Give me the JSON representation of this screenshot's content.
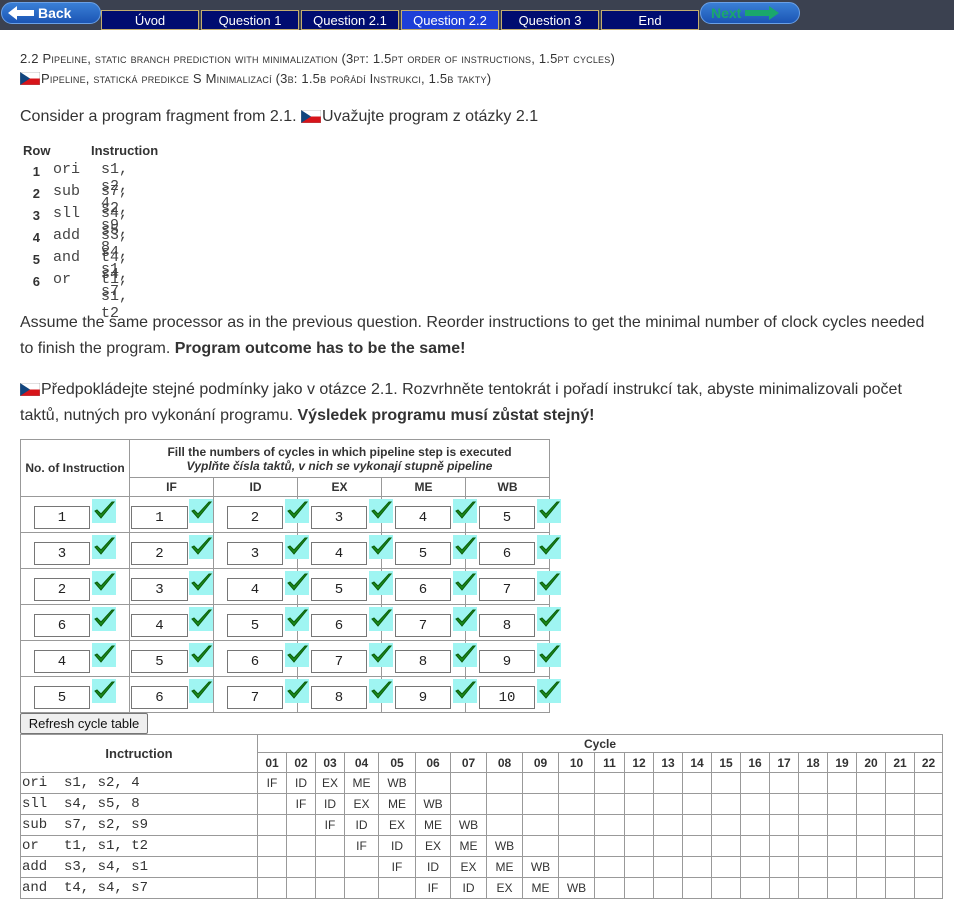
{
  "nav": {
    "back_label": "Back",
    "next_label": "Next",
    "tabs": [
      "Úvod",
      "Question 1",
      "Question 2.1",
      "Question 2.2",
      "Question 3",
      "End"
    ],
    "active_tab": "Question 2.2"
  },
  "heading": {
    "en": "2.2 Pipeline, static branch prediction with minimalization (3pt: 1.5pt order of instructions, 1.5pt cycles)",
    "cz": "Pipeline, statická predikce S Minimalizací (3b: 1.5b pořádí Instrukci, 1.5b takty)"
  },
  "intro": {
    "en": "Consider a program fragment from 2.1.",
    "cz": "Uvažujte program z otázky 2.1"
  },
  "program": {
    "col_row": "Row",
    "col_instruction": "Instruction",
    "rows": [
      {
        "num": "1",
        "op": "ori",
        "args": "s1, s2, 4"
      },
      {
        "num": "2",
        "op": "sub",
        "args": "s7, s2, s9"
      },
      {
        "num": "3",
        "op": "sll",
        "args": "s4, s5, 8"
      },
      {
        "num": "4",
        "op": "add",
        "args": "s3, s4, s1"
      },
      {
        "num": "5",
        "op": "and",
        "args": "t4, s4, s7"
      },
      {
        "num": "6",
        "op": "or",
        "args": "t1, s1, t2"
      }
    ]
  },
  "assume": {
    "en": "Assume the same processor as in the previous question. Reorder instructions to get the minimal number of clock cycles needed to finish the program.",
    "en_bold": "Program outcome has to be the same!",
    "cz": "Předpokládejte stejné podmínky jako v otázce 2.1. Rozvrhněte tentokrát i pořadí instrukcí tak, abyste minimalizovali počet taktů, nutných pro vykonání programu.",
    "cz_bold": "Výsledek programu musí zůstat stejný!"
  },
  "order_table": {
    "col_no": "No. of Instruction",
    "fill_en": "Fill the numbers of cycles in which pipeline step is executed",
    "fill_cz": "Vyplňte čísla taktů, v nich se vykonají stupně pipeline",
    "stages": [
      "IF",
      "ID",
      "EX",
      "ME",
      "WB"
    ],
    "rows": [
      {
        "instr": "1",
        "cycles": [
          "1",
          "2",
          "3",
          "4",
          "5"
        ]
      },
      {
        "instr": "3",
        "cycles": [
          "2",
          "3",
          "4",
          "5",
          "6"
        ]
      },
      {
        "instr": "2",
        "cycles": [
          "3",
          "4",
          "5",
          "6",
          "7"
        ]
      },
      {
        "instr": "6",
        "cycles": [
          "4",
          "5",
          "6",
          "7",
          "8"
        ]
      },
      {
        "instr": "4",
        "cycles": [
          "5",
          "6",
          "7",
          "8",
          "9"
        ]
      },
      {
        "instr": "5",
        "cycles": [
          "6",
          "7",
          "8",
          "9",
          "10"
        ]
      }
    ],
    "check_color": "#1b8a1b",
    "check_bg": "#9ff5f2"
  },
  "refresh_label": "Refresh cycle table",
  "cycle_table": {
    "instr_header": "Inctruction",
    "cycle_header": "Cycle",
    "cycles": [
      "01",
      "02",
      "03",
      "04",
      "05",
      "06",
      "07",
      "08",
      "09",
      "10",
      "11",
      "12",
      "13",
      "14",
      "15",
      "16",
      "17",
      "18",
      "19",
      "20",
      "21",
      "22"
    ],
    "rows": [
      {
        "instr": "ori  s1, s2, 4",
        "start": 1
      },
      {
        "instr": "sll  s4, s5, 8",
        "start": 2
      },
      {
        "instr": "sub  s7, s2, s9",
        "start": 3
      },
      {
        "instr": "or   t1, s1, t2",
        "start": 4
      },
      {
        "instr": "add  s3, s4, s1",
        "start": 5
      },
      {
        "instr": "and  t4, s4, s7",
        "start": 6
      }
    ]
  }
}
